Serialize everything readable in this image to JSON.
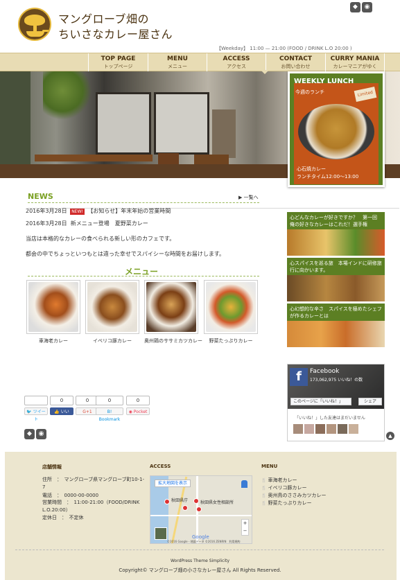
{
  "header": {
    "title_line1": "マングローブ畑の",
    "title_line2": "ちいさなカレー屋さん",
    "hours": "【Weekday】 11:00 — 21:00 (FOOD / DRINK L.O 20:00 )"
  },
  "nav": {
    "items": [
      {
        "label": "TOP PAGE",
        "sub": "トップページ"
      },
      {
        "label": "MENU",
        "sub": "メニュー"
      },
      {
        "label": "ACCESS",
        "sub": "アクセス"
      },
      {
        "label": "CONTACT",
        "sub": "お問い合わせ"
      },
      {
        "label": "CURRY MANIA",
        "sub": "カレーマニアがゆく"
      }
    ]
  },
  "lunch": {
    "title": "WEEKLY LUNCH",
    "subtitle": "今週のランチ",
    "tag": "Limited",
    "caption1": "心石焼カレー",
    "caption2": "ランチタイム12:00～13:00"
  },
  "news": {
    "heading": "NEWS",
    "more": "一覧へ",
    "items": [
      {
        "date": "2016年3月28日",
        "badge": "NEW!",
        "text": "【お知らせ】年末年始の営業時間"
      },
      {
        "date": "2016年3月28日",
        "text": "新メニュー登場　夏野菜カレー"
      }
    ]
  },
  "intro": {
    "line1": "当店は本格的なカレーの食べられる新しい形のカフェです。",
    "line2": "都会の中でちょっといつもとは違った幸せでスパイシーな時間をお届けします。"
  },
  "menu_section": {
    "heading": "メニュー",
    "dishes": [
      {
        "name": "車海老カレー"
      },
      {
        "name": "イベリコ豚カレー"
      },
      {
        "name": "奥州鶏のササミカツカレー"
      },
      {
        "name": "野菜たっぷりカレー"
      }
    ]
  },
  "share": {
    "tweet": {
      "count": "",
      "label": "ツイート"
    },
    "like": {
      "count": "0",
      "label": "いいね！"
    },
    "gplus": {
      "count": "0",
      "label": "G+1"
    },
    "bookmark": {
      "count": "0",
      "label": "Bookmark"
    },
    "pocket": {
      "count": "0",
      "label": "Pocket"
    }
  },
  "sidebar": {
    "banner1": "心どんなカレーが好きですか？　第一回　俺の好きなカレーはこれだ！選手権",
    "banner2": "心スパイスを巡る旅　本場インドに研修旅行に向かいます。",
    "banner3": "心幻想的な辛さ　スパイスを極めたシェフが作るカレーとは"
  },
  "facebook": {
    "name": "Facebook",
    "likes": "173,062,975 いいね！の数",
    "like_btn": "このページに「いいね！」",
    "share_btn": "シェア",
    "msg": "「いいね！」した友達はまだいません"
  },
  "footer": {
    "store_heading": "店舗情報",
    "address": "住所　：　マングローブ県マングローブ町10-1-7",
    "phone": "電話　：　0000-00-0000",
    "hours": "営業時間　：　11:00-21:00（FOOD/DRINK L.O.20:00）",
    "closed": "定休日　：　不定休",
    "access_heading": "ACCESS",
    "map": {
      "enlarge": "拡大地図を表示",
      "label1": "秋田県庁",
      "label2": "秋田県女性相談所",
      "google": "Google",
      "copyright": "©2016 Google - 地図データ ©2016 ZENRIN　利用規約"
    },
    "menu_heading": "MENU",
    "menu_items": [
      "車海老カレー",
      "イベリコ豚カレー",
      "奥州鳥のささみカツカレー",
      "野菜たっぷりカレー"
    ],
    "theme": "WordPress Theme Simplicity",
    "copyright": "Copyright© マングローブ畑の小さなカレー屋さん All Rights Reserved."
  },
  "colors": {
    "accent_green": "#7aa022",
    "nav_bg": "#e8dcb4",
    "footer_bg": "#ece6cf",
    "brown": "#4a3210"
  }
}
